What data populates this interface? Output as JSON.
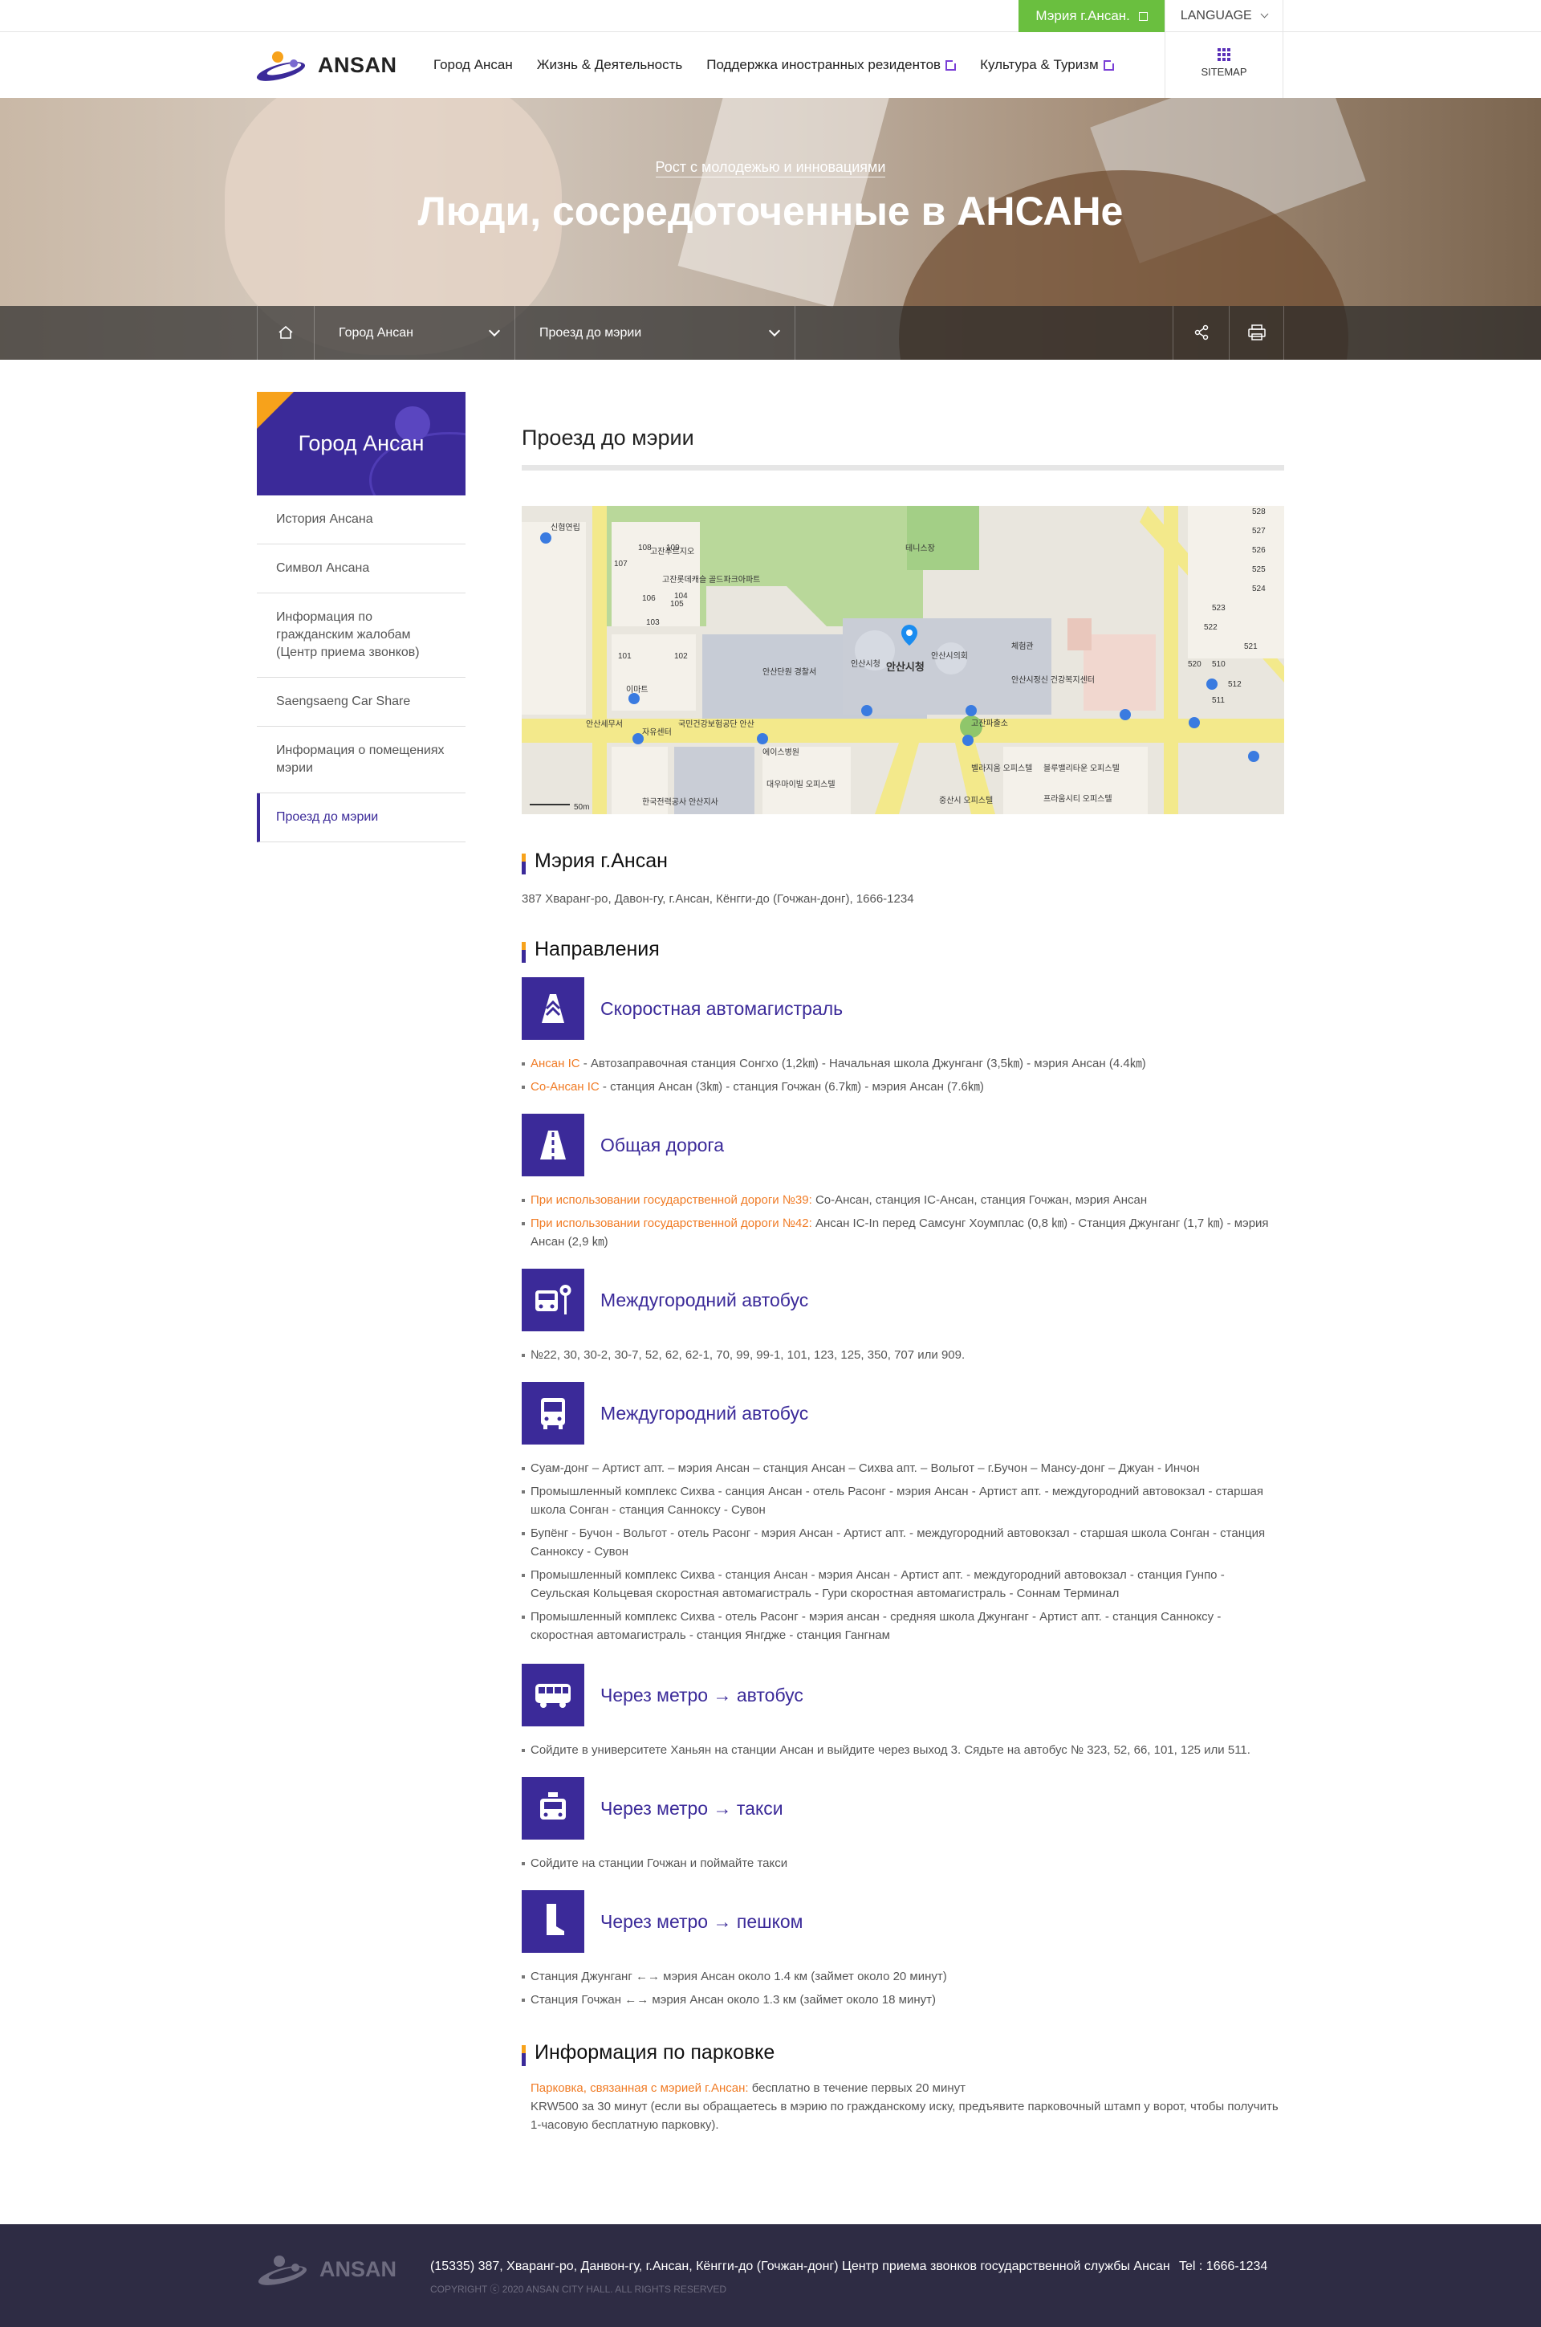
{
  "top_bar": {
    "cityhall_link": "Мэрия г.Ансан.",
    "language": "LANGUAGE"
  },
  "header": {
    "logo_text": "ANSAN",
    "nav": [
      {
        "label": "Город Ансан"
      },
      {
        "label": "Жизнь & Деятельность"
      },
      {
        "label": "Поддержка иностранных резидентов"
      },
      {
        "label": "Культура & Туризм"
      }
    ],
    "sitemap": "SITEMAP"
  },
  "hero": {
    "subtitle": "Рост с молодежью и инновациями",
    "title": "Люди, сосредоточенные в АНСАНе"
  },
  "breadcrumb": {
    "level1": "Город Ансан",
    "level2": "Проезд до мэрии"
  },
  "sidebar": {
    "title": "Город Ансан",
    "items": [
      {
        "label": "История Ансана"
      },
      {
        "label": "Символ Ансана"
      },
      {
        "label": "Информация по гражданским жалобам (Центр приема звонков)"
      },
      {
        "label": "Saengsaeng Car Share"
      },
      {
        "label": "Информация о помещениях мэрии"
      },
      {
        "label": "Проезд до мэрии"
      }
    ]
  },
  "content": {
    "page_title": "Проезд до мэрии",
    "map": {
      "labels": [
        "신협연립",
        "고잔푸르지오",
        "고잔롯데캐슬 골드파크아파트",
        "테니스장",
        "안산시청",
        "안산단원 경찰서",
        "안산시의회",
        "인산시청",
        "체험관",
        "안산시정신 건강복지센터",
        "이마트",
        "안산세무서",
        "자유센터",
        "국민건강보험공단 안산",
        "에이스병원",
        "고잔파출소",
        "대우마이빌 오피스텔",
        "벨라지움 오피스텔",
        "블루밸리타운 오피스텔",
        "중산시 오피스텔",
        "프라움시티 오피스텔",
        "한국전력공사 안산지사",
        "50m"
      ],
      "buildings": [
        "528",
        "527",
        "526",
        "525",
        "524",
        "523",
        "522",
        "521",
        "520",
        "510",
        "512",
        "511",
        "109",
        "108",
        "107",
        "106",
        "105",
        "104",
        "103",
        "102",
        "101"
      ]
    },
    "cityhall": {
      "heading": "Мэрия г.Ансан",
      "address": "387 Хваранг-ро, Давон-гу, г.Ансан, Кёнгги-до (Гочжан-донг), 1666-1234"
    },
    "directions_heading": "Направления",
    "modes": [
      {
        "icon": "expressway-icon",
        "title": "Скоростная автомагистраль",
        "items": [
          {
            "hl": "Ансан IC",
            "text": " - Автозаправочная станция Сонгхо (1,2㎞) - Начальная школа Джунганг (3,5㎞) - мэрия Ансан (4.4㎞)"
          },
          {
            "hl": "Со-Ансан IC",
            "text": " - станция Ансан (3㎞) - станция Гочжан (6.7㎞) - мэрия Ансан (7.6㎞)"
          }
        ]
      },
      {
        "icon": "road-icon",
        "title": "Общая дорога",
        "items": [
          {
            "hl": "При использовании государственной дороги №39:",
            "text": " Со-Ансан, станция IC-Ансан, станция Гочжан, мэрия Ансан"
          },
          {
            "hl": "При использовании государственной дороги №42:",
            "text": " Ансан IC-In перед Самсунг Хоумплас (0,8 ㎞) - Станция Джунганг (1,7 ㎞) - мэрия Ансан (2,9 ㎞)"
          }
        ]
      },
      {
        "icon": "bus-stop-icon",
        "title": "Междугородний автобус",
        "items": [
          {
            "hl": "",
            "text": "№22, 30, 30-2, 30-7, 52, 62, 62-1, 70, 99, 99-1, 101, 123, 125, 350, 707 или 909."
          }
        ]
      },
      {
        "icon": "bus-icon",
        "title": "Междугородний автобус",
        "items": [
          {
            "hl": "",
            "text": "Суам-донг – Артист апт. – мэрия Ансан – станция Ансан – Сихва апт. – Вольгот – г.Бучон – Мансу-донг – Джуан - Инчон"
          },
          {
            "hl": "",
            "text": "Промышленный комплекс Сихва - санция Ансан - отель Расонг - мэрия Ансан - Артист апт. - междугородний автовокзал - старшая школа Сонган - станция Санноксу - Сувон"
          },
          {
            "hl": "",
            "text": "Бупёнг - Бучон - Вольгот - отель Расонг - мэрия Ансан - Артист апт. - междугородний автовокзал - старшая школа Сонган - станция Санноксу - Сувон"
          },
          {
            "hl": "",
            "text": "Промышленный комплекс Сихва - станция Ансан - мэрия Ансан - Артист апт. - междугородний автовокзал - станция Гунпо - Сеульская Кольцевая скоростная автомагистраль - Гури скоростная автомагистраль - Соннам Терминал"
          },
          {
            "hl": "",
            "text": "Промышленный комплекс Сихва - отель Расонг - мэрия ансан - средняя школа Джунганг - Артист апт. - станция Санноксу - скоростная автомагистраль - станция Янгдже - станция Гангнам"
          }
        ]
      },
      {
        "icon": "subway-bus-icon",
        "title": "Через метро → автобус",
        "items": [
          {
            "hl": "",
            "text": "Сойдите в университете Ханьян на станции Ансан и выйдите через выход 3. Сядьте на автобус № 323, 52, 66, 101, 125 или 511."
          }
        ]
      },
      {
        "icon": "taxi-icon",
        "title": "Через метро → такси",
        "items": [
          {
            "hl": "",
            "text": "Сойдите на станции Гочжан и поймайте такси"
          }
        ]
      },
      {
        "icon": "walk-icon",
        "title": "Через метро → пешком",
        "items": [
          {
            "hl": "",
            "text": "Станция Джунганг ←→ мэрия Ансан около 1.4 км (займет около 20 минут)"
          },
          {
            "hl": "",
            "text": "Станция Гочжан ←→ мэрия Ансан около 1.3 км (займет около 18 минут)"
          }
        ]
      }
    ],
    "parking": {
      "heading": "Информация по парковке",
      "hl": "Парковка, связанная с мэрией г.Ансан:",
      "line1": " бесплатно в течение первых 20 минут",
      "line2": "KRW500 за 30 минут (если вы обращаетесь в мэрию по гражданскому иску, предъявите парковочный штамп у ворот, чтобы получить 1-часовую бесплатную парковку)."
    }
  },
  "footer": {
    "logo_text": "ANSAN",
    "address": "(15335) 387, Хваранг-ро, Данвон-гу, г.Ансан, Кёнгги-до (Гочжан-донг) Центр приема звонков государственной службы Ансан",
    "tel": "Tel : 1666-1234",
    "copyright": "COPYRIGHT ⓒ 2020 ANSAN CITY HALL. ALL RIGHTS RESERVED"
  },
  "colors": {
    "brand": "#3b2a99",
    "accent": "#f7a21b",
    "highlight": "#f07b25",
    "green": "#6abf3f",
    "footer": "#2e2c44"
  }
}
